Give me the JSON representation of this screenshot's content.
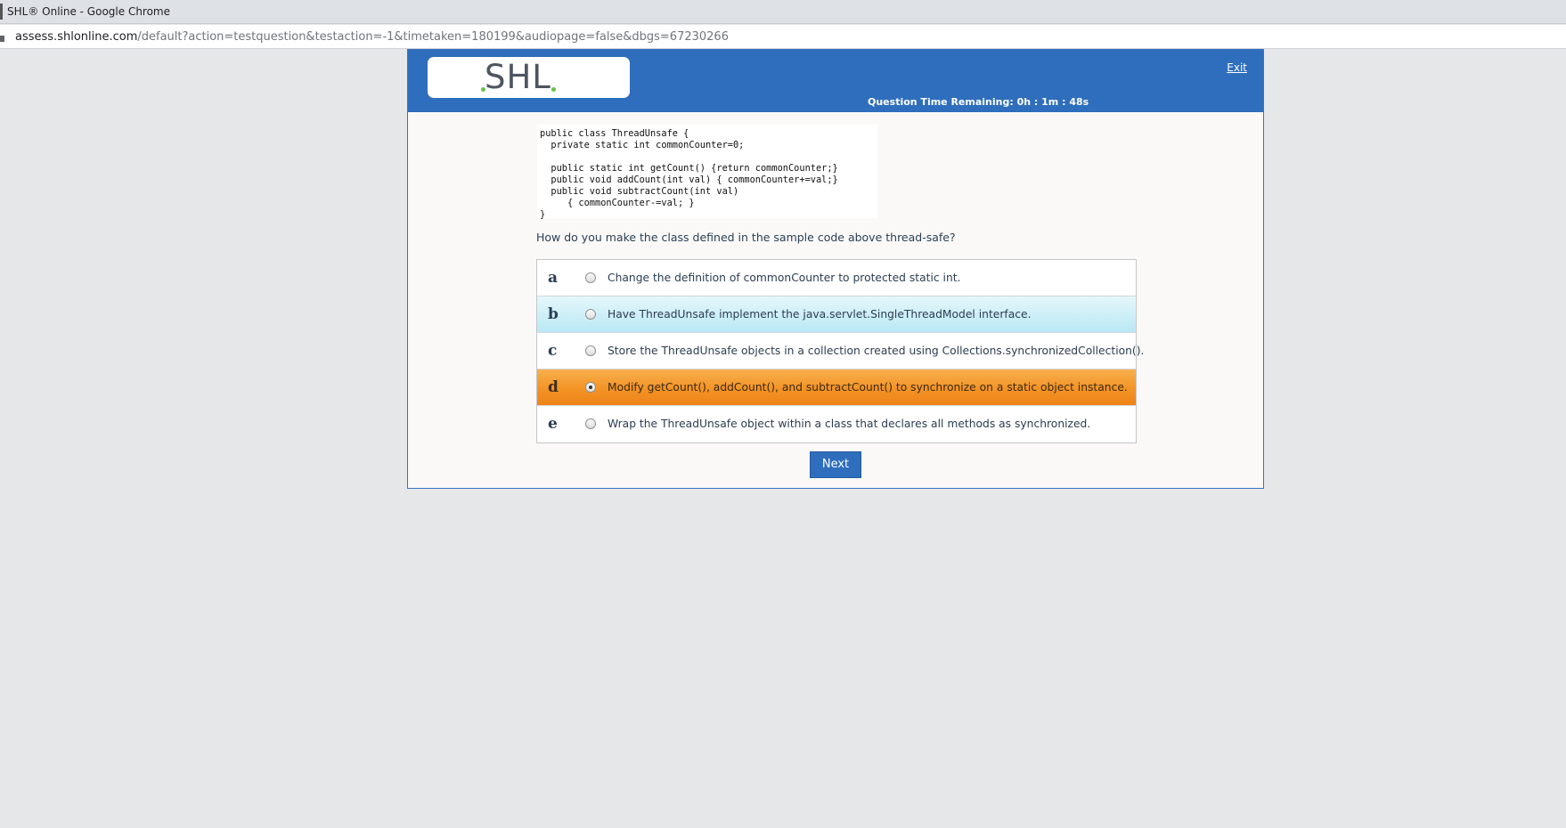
{
  "browser": {
    "window_title": "SHL® Online - Google Chrome",
    "url_host": "assess.shlonline.com",
    "url_path": "/default?action=testquestion&testaction=-1&timetaken=180199&audiopage=false&dbgs=67230266"
  },
  "header": {
    "logo_text": "SHL",
    "exit_label": "Exit",
    "timer_label": "Question Time Remaining:",
    "timer_value": "0h : 1m : 48s",
    "brand_color": "#2e6ebd",
    "logo_dot_color": "#6cc24a"
  },
  "code_sample": "public class ThreadUnsafe {\n  private static int commonCounter=0;\n\n  public static int getCount() {return commonCounter;}\n  public void addCount(int val) { commonCounter+=val;}\n  public void subtractCount(int val)\n     { commonCounter-=val; }\n}",
  "question": "How do you make the class defined in the sample code above thread-safe?",
  "options": [
    {
      "letter": "a",
      "text": "Change the definition of commonCounter to protected static int.",
      "state": "normal"
    },
    {
      "letter": "b",
      "text": "Have ThreadUnsafe implement the java.servlet.SingleThreadModel interface.",
      "state": "hover"
    },
    {
      "letter": "c",
      "text": "Store the ThreadUnsafe objects in a collection created using Collections.synchronizedCollection().",
      "state": "normal"
    },
    {
      "letter": "d",
      "text": "Modify getCount(), addCount(), and subtractCount() to synchronize on a static object instance.",
      "state": "selected"
    },
    {
      "letter": "e",
      "text": "Wrap the ThreadUnsafe object within a class that declares all methods as synchronized.",
      "state": "normal"
    }
  ],
  "selected_option": "d",
  "next_label": "Next"
}
